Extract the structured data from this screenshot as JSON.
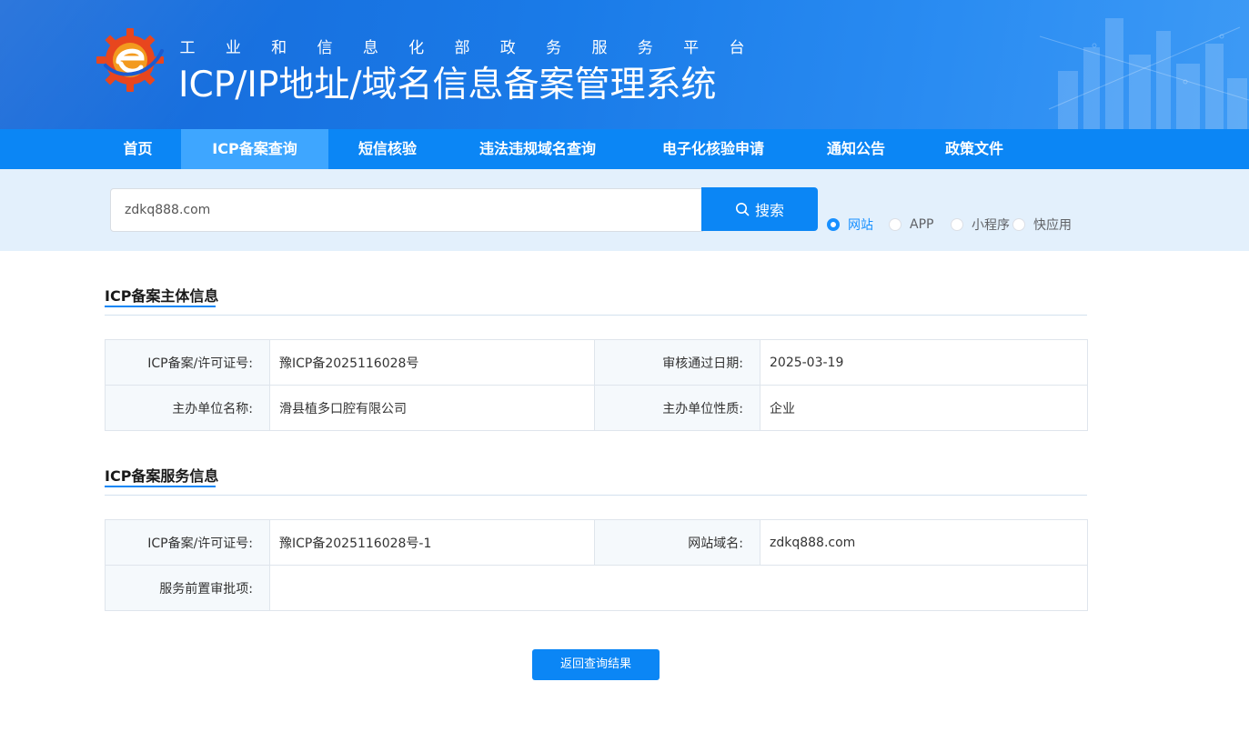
{
  "header": {
    "subtitle_chars": [
      "工",
      "业",
      "和",
      "信",
      "息",
      "化",
      "部",
      "政",
      "务",
      "服",
      "务",
      "平",
      "台"
    ],
    "title": "ICP/IP地址/域名信息备案管理系统"
  },
  "nav": {
    "items": [
      {
        "label": "首页",
        "active": false
      },
      {
        "label": "ICP备案查询",
        "active": true
      },
      {
        "label": "短信核验",
        "active": false
      },
      {
        "label": "违法违规域名查询",
        "active": false
      },
      {
        "label": "电子化核验申请",
        "active": false
      },
      {
        "label": "通知公告",
        "active": false
      },
      {
        "label": "政策文件",
        "active": false
      }
    ]
  },
  "search": {
    "value": "zdkq888.com",
    "button_label": "搜索",
    "options": [
      {
        "label": "网站",
        "checked": true
      },
      {
        "label": "APP",
        "checked": false
      },
      {
        "label": "小程序",
        "checked": false
      },
      {
        "label": "快应用",
        "checked": false
      }
    ]
  },
  "subject_info": {
    "title": "ICP备案主体信息",
    "rows": [
      {
        "label1": "ICP备案/许可证号:",
        "value1": "豫ICP备2025116028号",
        "label2": "审核通过日期:",
        "value2": "2025-03-19"
      },
      {
        "label1": "主办单位名称:",
        "value1": "滑县植多口腔有限公司",
        "label2": "主办单位性质:",
        "value2": "企业"
      }
    ]
  },
  "service_info": {
    "title": "ICP备案服务信息",
    "row1": {
      "label1": "ICP备案/许可证号:",
      "value1": "豫ICP备2025116028号-1",
      "label2": "网站域名:",
      "value2": "zdkq888.com"
    },
    "row2": {
      "label": "服务前置审批项:",
      "value": ""
    }
  },
  "footer": {
    "back_label": "返回查询结果"
  },
  "colors": {
    "primary": "#0b86f5",
    "nav_active": "#3ea6ff",
    "search_strip": "#e3f0fc",
    "label_bg": "#f5f9fc"
  }
}
